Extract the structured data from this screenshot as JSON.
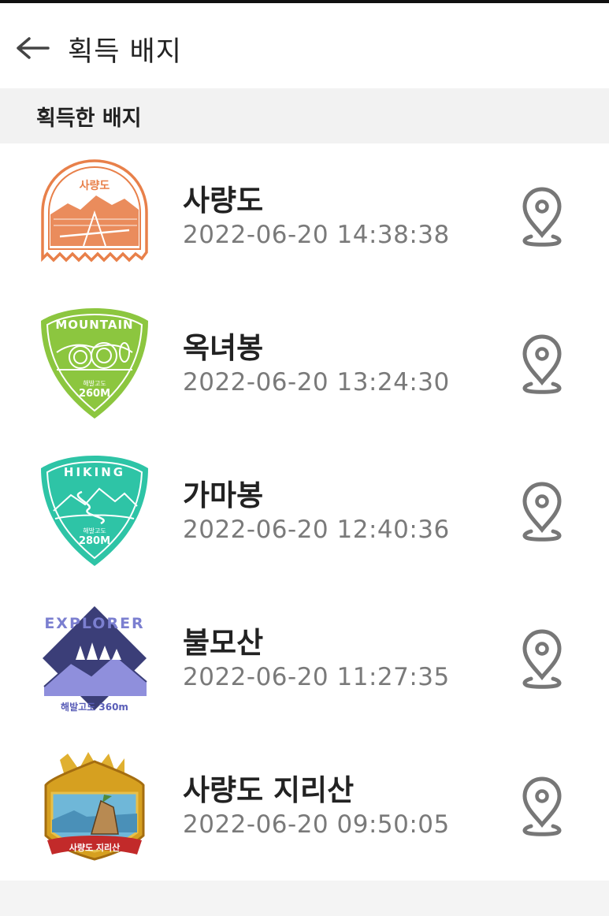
{
  "header": {
    "title": "획득 배지",
    "back_icon": "arrow-left-icon"
  },
  "section": {
    "title": "획득한 배지"
  },
  "badges": [
    {
      "name": "사량도",
      "acquired_at": "2022-06-20 14:38:38",
      "badge_label": "사량도",
      "color": "#e8804a"
    },
    {
      "name": "옥녀봉",
      "acquired_at": "2022-06-20 13:24:30",
      "badge_label": "MOUNTAIN",
      "badge_sub1": "해발고도",
      "badge_sub2": "260M",
      "color": "#8cc63f"
    },
    {
      "name": "가마봉",
      "acquired_at": "2022-06-20 12:40:36",
      "badge_label": "HIKING",
      "badge_sub1": "해발고도",
      "badge_sub2": "280M",
      "color": "#2ec4a6"
    },
    {
      "name": "불모산",
      "acquired_at": "2022-06-20 11:27:35",
      "badge_label": "EXPLORER",
      "badge_sub1": "해발고도 360m",
      "color": "#3b3e78"
    },
    {
      "name": "사량도 지리산",
      "acquired_at": "2022-06-20 09:50:05",
      "badge_label": "사량도 지리산",
      "color": "#d6a020"
    }
  ],
  "pin_icon": "location-pin-icon"
}
